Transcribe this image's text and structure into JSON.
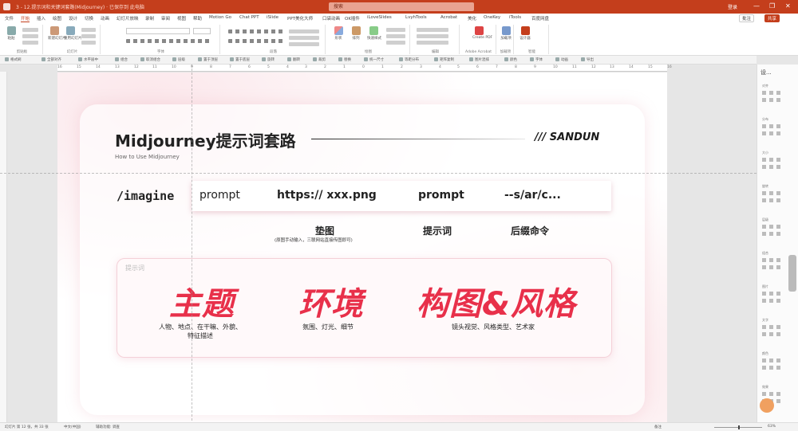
{
  "titlebar": {
    "doc_title": "3 - 12.提示词和关键词套路(Midjourney) · 已保存到 此电脑",
    "search_placeholder": "搜索",
    "user": "登录",
    "minimize": "—",
    "maximize": "❐",
    "close": "✕"
  },
  "menu": {
    "tabs": [
      "文件",
      "开始",
      "插入",
      "绘图",
      "设计",
      "切换",
      "动画",
      "幻灯片放映",
      "录制",
      "审阅",
      "视图",
      "帮助",
      "Motion Go",
      "Chat PPT",
      "iSlide",
      "PPT美化大师",
      "口袋动画",
      "OK插件",
      "iLoveSlides",
      "LvyhTools",
      "Acrobat",
      "美化",
      "OneKey",
      "iTools",
      "百度网盘"
    ],
    "active_index": 1,
    "right_buttons": [
      "批注",
      "共享"
    ]
  },
  "ribbon": {
    "groups": [
      "剪贴板",
      "幻灯片",
      "字体",
      "段落",
      "绘图",
      "编辑",
      "Adobe Acrobat",
      "加载项",
      "智能"
    ],
    "buttons": [
      "粘贴",
      "新建幻灯片",
      "重用幻灯片",
      "形状",
      "排列",
      "快速样式",
      "Create PDF",
      "加载项",
      "设计器"
    ]
  },
  "quickbar": {
    "items": [
      "格式刷",
      "全部对齐",
      "水平居中",
      "组合",
      "取消组合",
      "层级",
      "置于顶层",
      "置于底层",
      "旋转",
      "翻转",
      "裁剪",
      "替换",
      "统一尺寸",
      "等距分布",
      "矩阵复制",
      "图片混排",
      "颜色",
      "字体",
      "动画",
      "导出"
    ]
  },
  "ruler": {
    "numbers": [
      "16",
      "15",
      "14",
      "13",
      "12",
      "11",
      "10",
      "9",
      "8",
      "7",
      "6",
      "5",
      "4",
      "3",
      "2",
      "1",
      "0",
      "1",
      "2",
      "3",
      "4",
      "5",
      "6",
      "7",
      "8",
      "9",
      "10",
      "11",
      "12",
      "13",
      "14",
      "15",
      "16"
    ]
  },
  "slide": {
    "title": "Midjourney提示词套路",
    "subtitle": "How to Use Midjourney",
    "brand": "/// SANDUN",
    "command": "/imagine",
    "prompt_items": [
      "prompt",
      "https:// xxx.png",
      "prompt",
      "--s/ar/c..."
    ],
    "labels": [
      "垫图",
      "提示词",
      "后缀命令"
    ],
    "note": "(原图手动输入，三联网站直接传图即可)",
    "box_label": "提示词",
    "big_words": [
      "主题",
      "环境",
      "构图&风格"
    ],
    "descriptions": [
      "人物、地点、在干嘛、外貌、\n特征描述",
      "氛围、灯光、细节",
      "镜头视觉、风格类型、艺术家"
    ]
  },
  "right_panel": {
    "title": "设...",
    "sections": [
      "对齐",
      "分布",
      "大小",
      "旋转",
      "层级",
      "组合",
      "图片",
      "文字",
      "颜色",
      "效果"
    ]
  },
  "statusbar": {
    "left": "幻灯片 第 12 张，共 33 张",
    "lang": "中文(中国)",
    "access": "辅助功能: 调查",
    "notes": "备注",
    "zoom": "63%"
  },
  "colors": {
    "accent": "#c43e1c",
    "highlight": "#e8304a"
  }
}
